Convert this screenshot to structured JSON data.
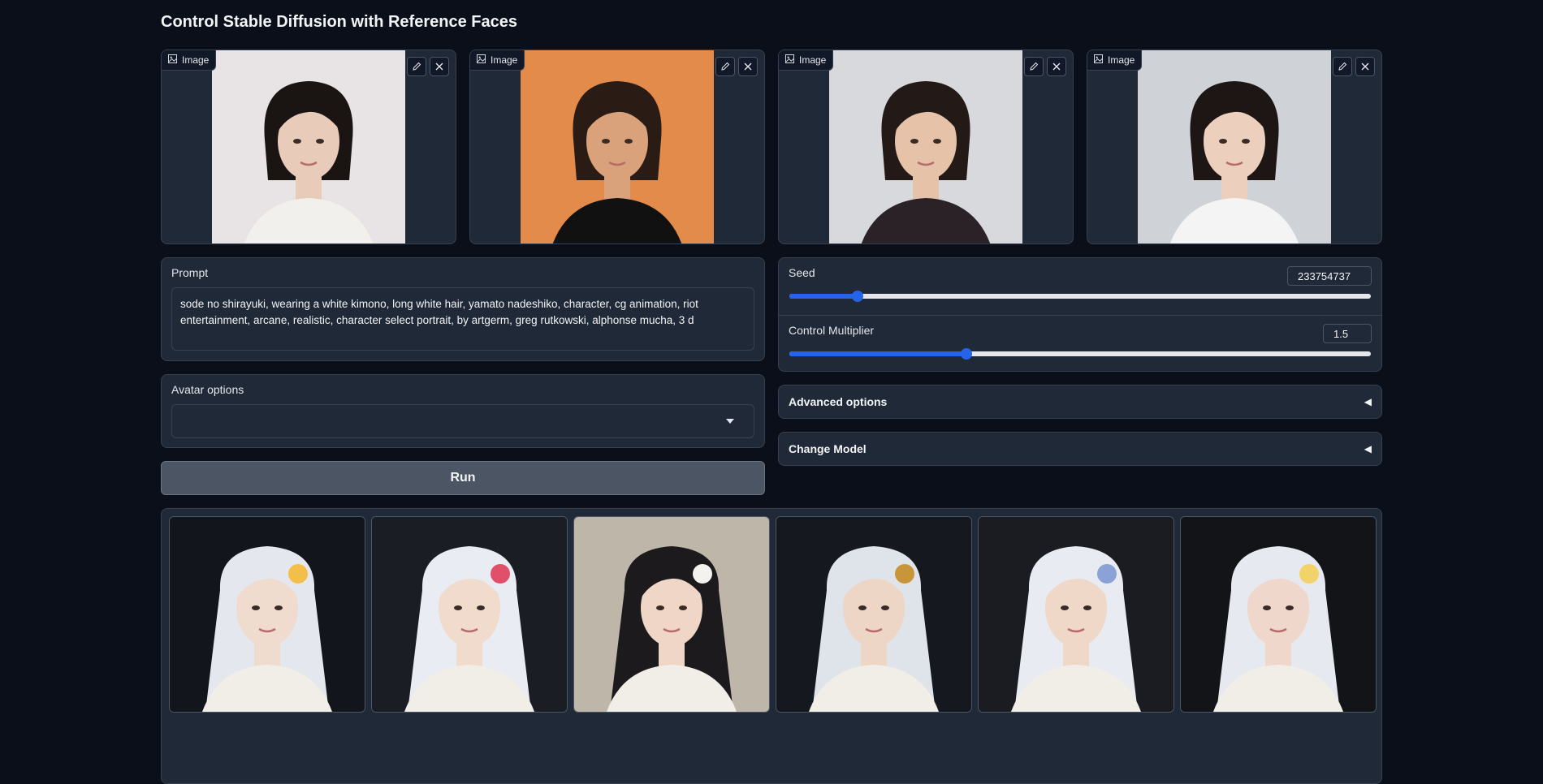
{
  "page": {
    "title": "Control Stable Diffusion with Reference Faces"
  },
  "reference_images": [
    {
      "label": "Image",
      "background": "#e8e4e6",
      "hair": "#1a1412",
      "skin": "#e8cbb8",
      "clothes": "#f2f0ec"
    },
    {
      "label": "Image",
      "background": "#e38b4a",
      "hair": "#2a1c14",
      "skin": "#d9a27a",
      "clothes": "#111111"
    },
    {
      "label": "Image",
      "background": "#d7d9dc",
      "hair": "#231a17",
      "skin": "#e6c3a8",
      "clothes": "#2a2226"
    },
    {
      "label": "Image",
      "background": "#cfd3d8",
      "hair": "#1e1614",
      "skin": "#ecd0bd",
      "clothes": "#f4f4f4"
    }
  ],
  "prompt": {
    "label": "Prompt",
    "value": "sode no shirayuki, wearing a white kimono, long white hair, yamato nadeshiko, character, cg animation, riot entertainment, arcane, realistic, character select portrait, by artgerm, greg rutkowski, alphonse mucha, 3 d"
  },
  "avatar_options": {
    "label": "Avatar options",
    "value": ""
  },
  "run_button": {
    "label": "Run"
  },
  "seed": {
    "label": "Seed",
    "value": "233754737",
    "fraction": 0.118
  },
  "control_multiplier": {
    "label": "Control Multiplier",
    "value": "1.5",
    "fraction": 0.305
  },
  "advanced_options": {
    "label": "Advanced options",
    "arrow": "◀"
  },
  "change_model": {
    "label": "Change Model",
    "arrow": "◀"
  },
  "gallery": [
    {
      "background": "#12151c",
      "hair": "#e4e7ee",
      "skin": "#f0dccf",
      "accent": "#f2c04a"
    },
    {
      "background": "#1a1d24",
      "hair": "#e9ecf2",
      "skin": "#f1dbcd",
      "accent": "#e0506a"
    },
    {
      "background": "#bfb6aa",
      "hair": "#1c1a1c",
      "skin": "#efd6c6",
      "accent": "#f3f2ef"
    },
    {
      "background": "#15181e",
      "hair": "#dfe3ea",
      "skin": "#eed6c6",
      "accent": "#c9953a"
    },
    {
      "background": "#1a1c22",
      "hair": "#e8ebf1",
      "skin": "#f0d8c9",
      "accent": "#8aa2d6"
    },
    {
      "background": "#121418",
      "hair": "#e6e9ef",
      "skin": "#efd8cb",
      "accent": "#f2d36a"
    }
  ],
  "colors": {
    "accent": "#2563eb",
    "panel": "#1f2937",
    "page_background": "#0b0f19",
    "border": "#374151"
  }
}
